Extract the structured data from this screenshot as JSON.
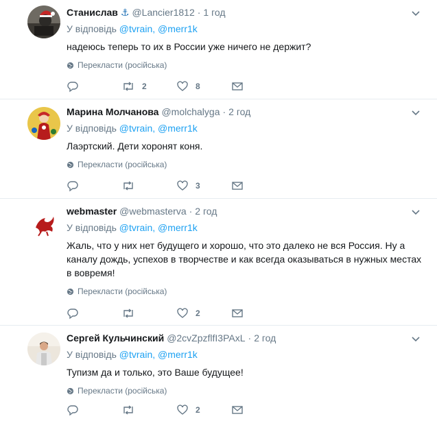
{
  "tweets": [
    {
      "name": "Станислав",
      "handle": "@Lancier1812",
      "time": "1 год",
      "reply_prefix": "У відповідь",
      "mention1": "@tvrain",
      "mention2": "@merr1k",
      "text": "надеюсь теперь то их в России уже ничего не держит?",
      "translate": "Перекласти (російська)",
      "retweets": "2",
      "likes": "8"
    },
    {
      "name": "Марина Молчанова",
      "handle": "@molchalyga",
      "time": "2 год",
      "reply_prefix": "У відповідь",
      "mention1": "@tvrain",
      "mention2": "@merr1k",
      "text": "Лаэртский. Дети хоронят коня.",
      "translate": "Перекласти (російська)",
      "retweets": "",
      "likes": "3"
    },
    {
      "name": "webmaster",
      "handle": "@webmasterva",
      "time": "2 год",
      "reply_prefix": "У відповідь",
      "mention1": "@tvrain",
      "mention2": "@merr1k",
      "text": "Жаль, что у них нет будущего и хорошо, что это далеко не вся Россия. Ну а каналу дождь, успехов в творчестве и как всегда оказываться в нужных местах в вовремя!",
      "translate": "Перекласти (російська)",
      "retweets": "",
      "likes": "2"
    },
    {
      "name": "Сергей Кульчинский",
      "handle": "@2cvZpzflfI3PAxL",
      "time": "2 год",
      "reply_prefix": "У відповідь",
      "mention1": "@tvrain",
      "mention2": "@merr1k",
      "text": "Тупизм да и только, это Ваше будущее!",
      "translate": "Перекласти (російська)",
      "retweets": "",
      "likes": "2"
    }
  ],
  "icons": {
    "verified": "anchor-icon",
    "caret": "chevron-down-icon",
    "globe": "globe-icon",
    "reply": "reply-icon",
    "retweet": "retweet-icon",
    "like": "heart-icon",
    "dm": "envelope-icon"
  },
  "colors": {
    "link": "#1da1f2",
    "muted": "#657786",
    "text": "#14171a",
    "divider": "#e6ecf0"
  }
}
